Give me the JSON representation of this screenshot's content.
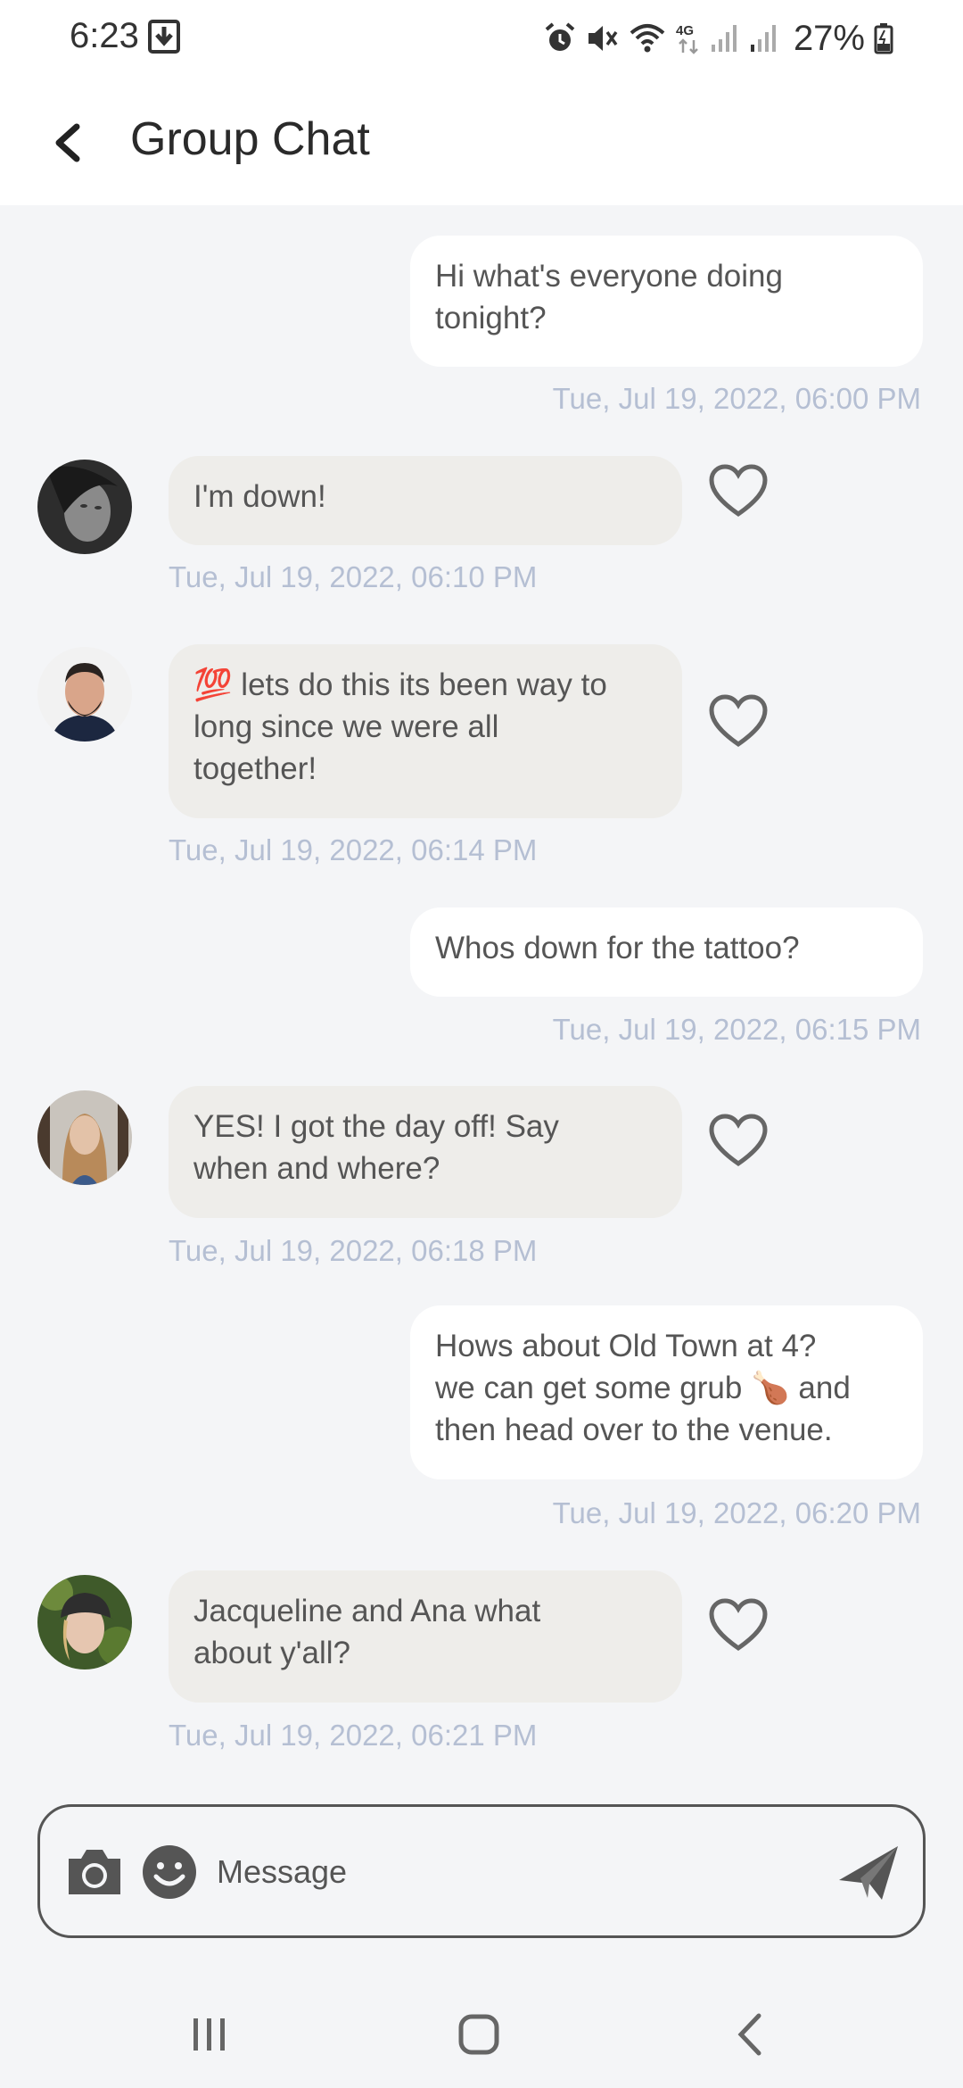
{
  "status_bar": {
    "time": "6:23",
    "battery": "27%",
    "network": "4G"
  },
  "header": {
    "title": "Group Chat"
  },
  "messages": [
    {
      "direction": "out",
      "text_lines": [
        "Hi what's everyone doing",
        "tonight?"
      ],
      "timestamp": "Tue, Jul 19, 2022, 06:00 PM"
    },
    {
      "direction": "in",
      "text_lines": [
        "I'm down!"
      ],
      "timestamp": "Tue, Jul 19, 2022, 06:10 PM",
      "liked": false
    },
    {
      "direction": "in",
      "text_lines": [
        "💯 lets do this its been way to",
        "long since we were all",
        "together!"
      ],
      "timestamp": "Tue, Jul 19, 2022, 06:14 PM",
      "liked": false
    },
    {
      "direction": "out",
      "text_lines": [
        "Whos down for the tattoo?"
      ],
      "timestamp": "Tue, Jul 19, 2022, 06:15 PM"
    },
    {
      "direction": "in",
      "text_lines": [
        "YES! I got the day off! Say",
        "when and where?"
      ],
      "timestamp": "Tue, Jul 19, 2022, 06:18 PM",
      "liked": false
    },
    {
      "direction": "out",
      "text_lines": [
        "Hows about Old Town at 4?",
        "we can get some grub 🍗 and",
        "then head over to the venue."
      ],
      "timestamp": "Tue, Jul 19, 2022, 06:20 PM"
    },
    {
      "direction": "in",
      "text_lines": [
        "Jacqueline and Ana what",
        "about y'all?"
      ],
      "timestamp": "Tue, Jul 19, 2022, 06:21 PM",
      "liked": false
    }
  ],
  "composer": {
    "placeholder": "Message"
  },
  "colors": {
    "background": "#f4f5f7",
    "incoming_bubble": "#eeedea",
    "outgoing_bubble": "#ffffff",
    "timestamp": "#b5bfd3",
    "text": "#555555"
  },
  "icons": [
    "download-icon",
    "alarm-icon",
    "mute-icon",
    "wifi-icon",
    "signal-icon",
    "battery-icon",
    "back-arrow-icon",
    "heart-icon",
    "camera-icon",
    "emoji-icon",
    "send-icon",
    "recent-apps-icon",
    "home-icon",
    "nav-back-icon"
  ]
}
